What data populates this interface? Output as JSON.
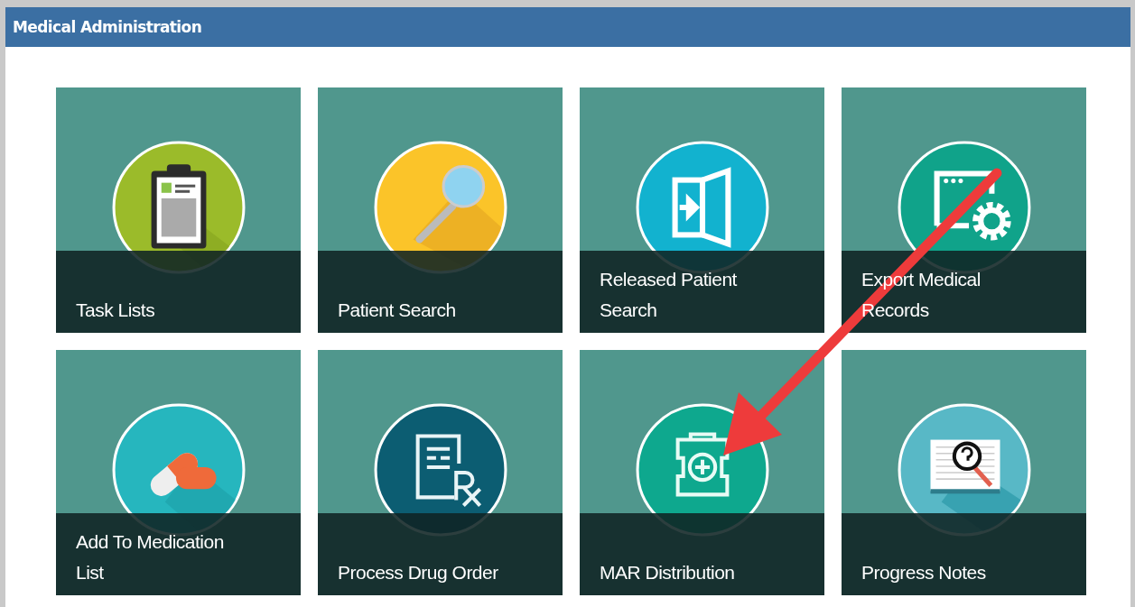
{
  "window": {
    "title": "Medical Administration"
  },
  "tiles": [
    {
      "label": "Task Lists",
      "kind": "clipboard"
    },
    {
      "label": "Patient Search",
      "kind": "magnifier"
    },
    {
      "label": "Released Patient Search",
      "kind": "door"
    },
    {
      "label": "Export Medical Records",
      "kind": "settings"
    },
    {
      "label": "Add To Medication List",
      "kind": "pills"
    },
    {
      "label": "Process Drug Order",
      "kind": "prescription"
    },
    {
      "label": "MAR Distribution",
      "kind": "medkit"
    },
    {
      "label": "Progress Notes",
      "kind": "book"
    }
  ]
}
